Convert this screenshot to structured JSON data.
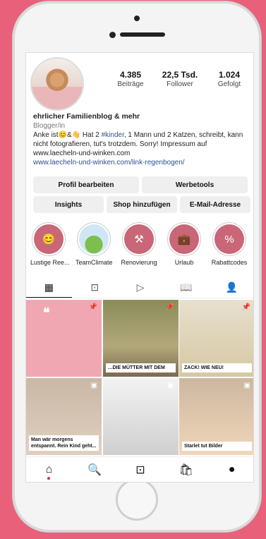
{
  "stats": [
    {
      "n": "4.385",
      "l": "Beiträge"
    },
    {
      "n": "22,5 Tsd.",
      "l": "Follower"
    },
    {
      "n": "1.024",
      "l": "Gefolgt"
    }
  ],
  "bio": {
    "name": "ehrlicher Familienblog & mehr",
    "category": "Blogger/in",
    "line1a": "Anke ist😊&👋 Hat 2 ",
    "hashtag": "#kinder",
    "line1b": ", 1 Mann und 2 Katzen, schreibt, kann nicht fotografieren, tut's trotzdem. Sorry! Impressum auf www.laecheln-und-winken.com",
    "link": "www.laecheln-und-winken.com/link-regenbogen/"
  },
  "buttons": {
    "profile": "Profil bearbeiten",
    "ads": "Werbetools",
    "insights": "Insights",
    "shop": "Shop hinzufügen",
    "email": "E-Mail-Adresse"
  },
  "highlights": [
    {
      "label": "Lustige Ree...",
      "icon": "😊"
    },
    {
      "label": "TeamClimate",
      "icon": ""
    },
    {
      "label": "Renovierung",
      "icon": "⚒"
    },
    {
      "label": "Urlaub",
      "icon": "💼"
    },
    {
      "label": "Rabattcodes",
      "icon": "%"
    }
  ],
  "tabs": [
    "▦",
    "⊡",
    "▷",
    "📖",
    "👤"
  ],
  "grid": [
    {
      "text": "…DIE MÜTTER MIT DEM"
    },
    {
      "text": "ZACK! WIE NEU!"
    },
    {
      "text": "Man wär morgens entspannt. Rein Kind geht..."
    },
    {
      "text": "Starlet tut Bilder"
    }
  ],
  "nav": [
    "⌂",
    "🔍",
    "⊡",
    "🛍",
    "●"
  ]
}
